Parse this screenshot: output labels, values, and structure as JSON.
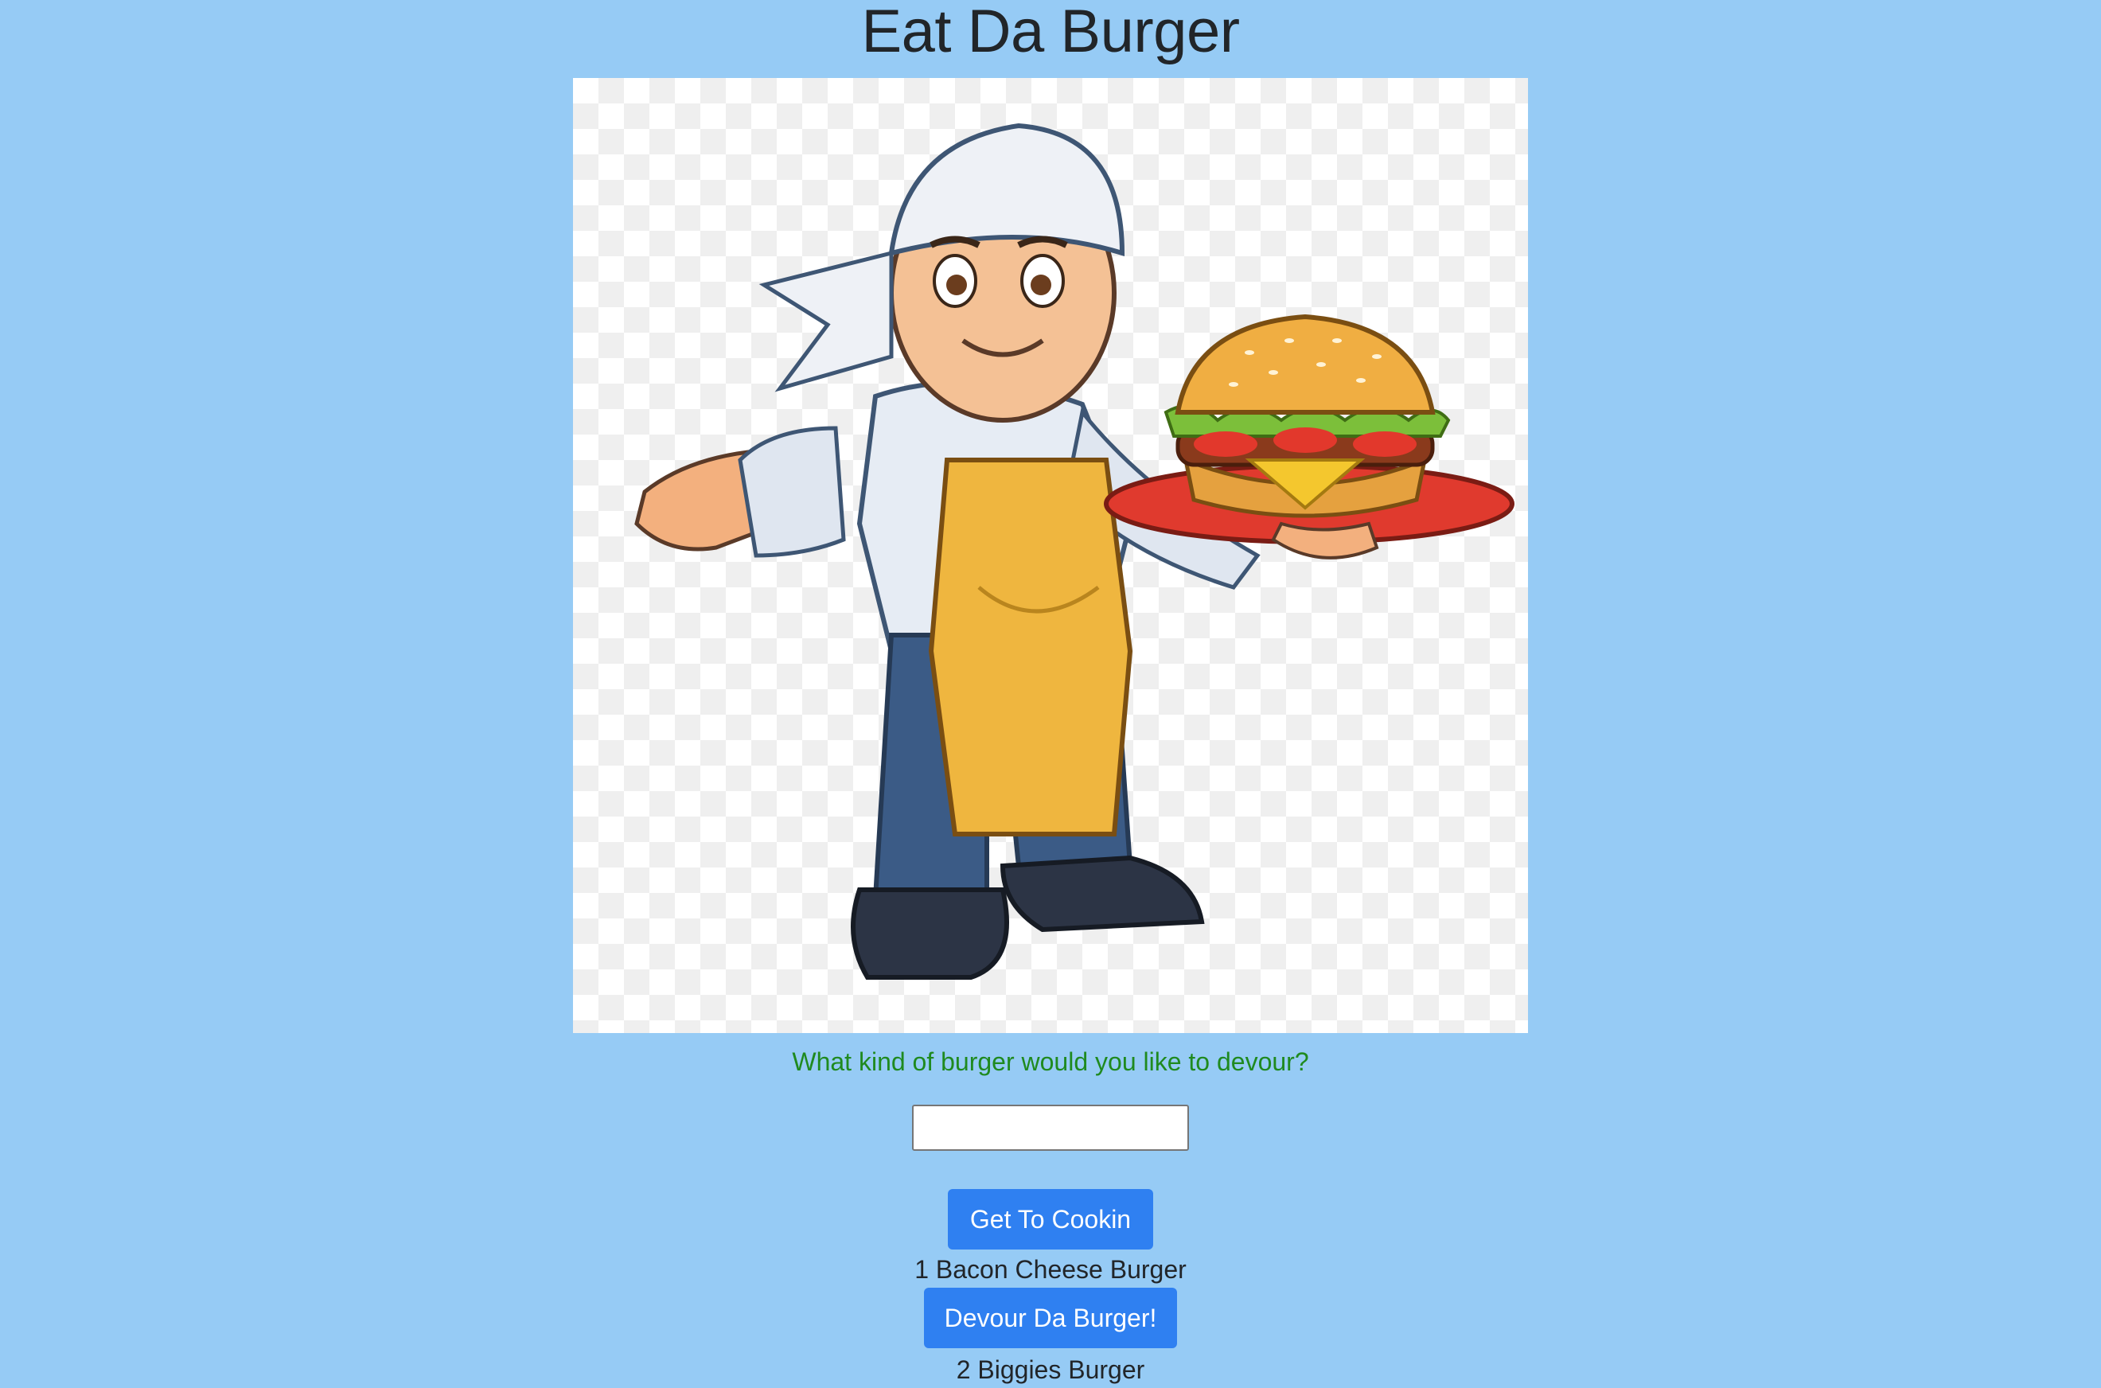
{
  "page": {
    "title": "Eat Da Burger"
  },
  "hero_image": {
    "alt": "Chef holding burger on a platter"
  },
  "form": {
    "prompt": "What kind of burger would you like to devour?",
    "input_value": "",
    "input_placeholder": "",
    "submit_label": "Get To Cookin"
  },
  "burgers": [
    {
      "label": "1 Bacon Cheese Burger",
      "button_label": "Devour Da Burger!"
    },
    {
      "label": "2 Biggies Burger"
    }
  ],
  "colors": {
    "background": "#96cbf5",
    "button": "#2f80f1",
    "prompt_text": "#1f8a1f"
  }
}
